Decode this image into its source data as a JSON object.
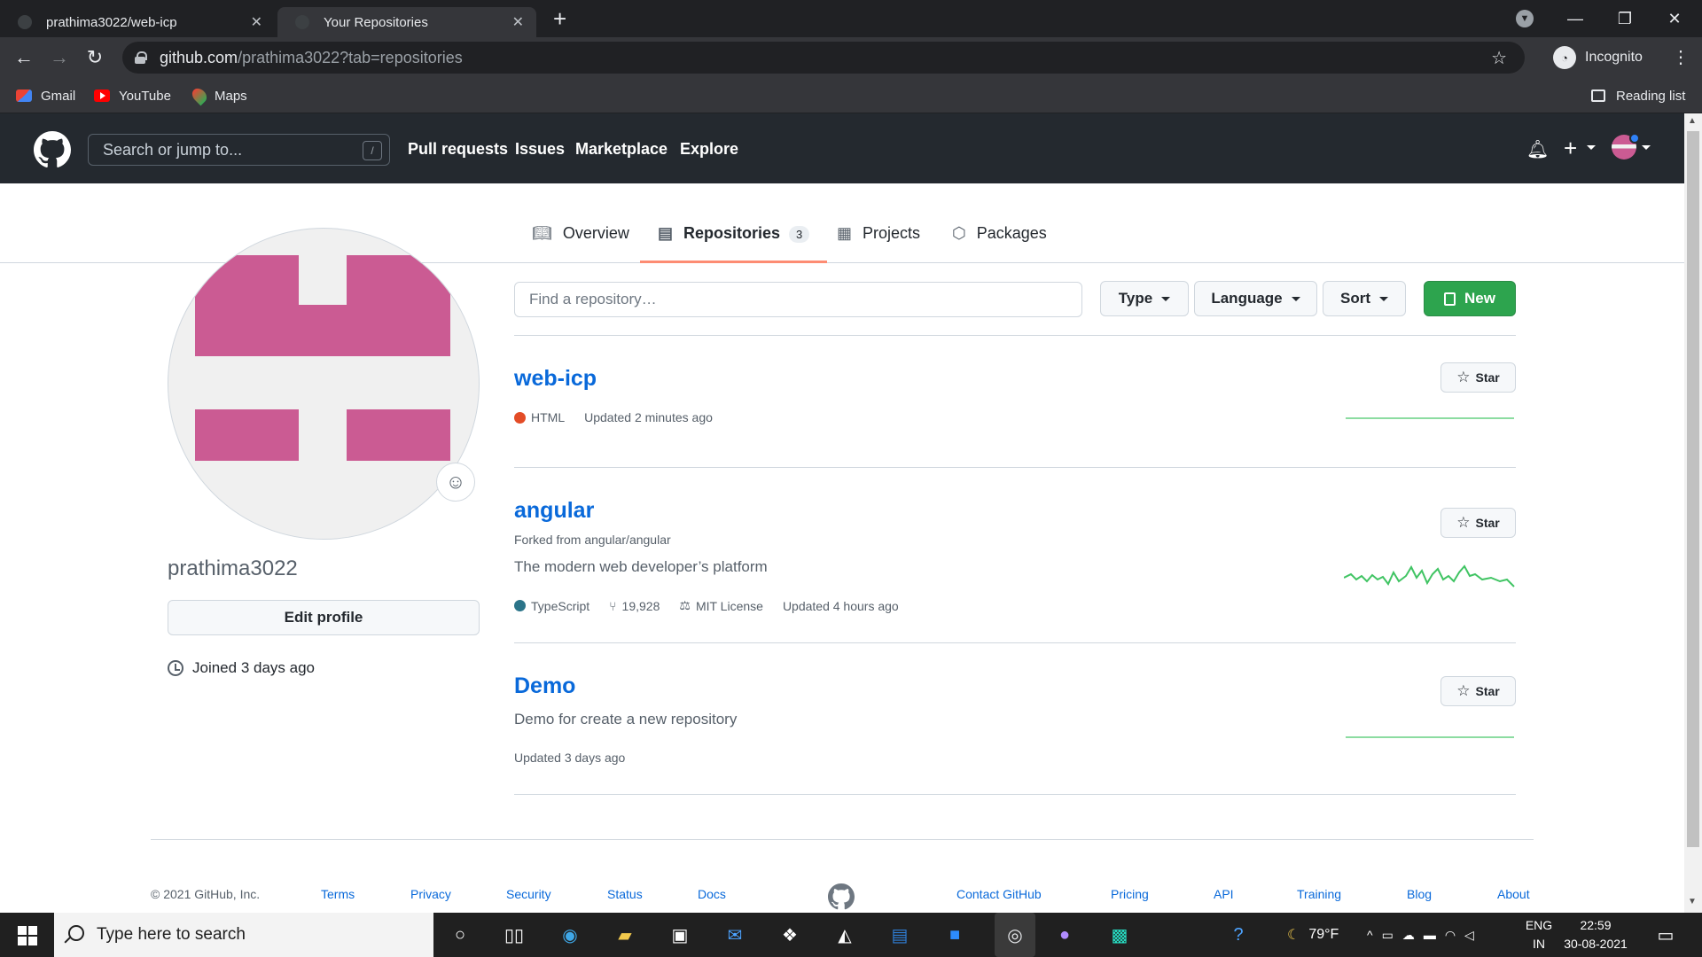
{
  "browser": {
    "tabs": [
      {
        "label": "prathima3022/web-icp",
        "active": false
      },
      {
        "label": "Your Repositories",
        "active": true
      }
    ],
    "url_host": "github.com",
    "url_path": "/prathima3022?tab=repositories",
    "profile_label": "Incognito",
    "bookmarks": [
      "Gmail",
      "YouTube",
      "Maps"
    ],
    "reading_list": "Reading list"
  },
  "github_header": {
    "search_placeholder": "Search or jump to...",
    "search_shortcut": "/",
    "nav": [
      "Pull requests",
      "Issues",
      "Marketplace",
      "Explore"
    ]
  },
  "profile_tabs": [
    {
      "label": "Overview",
      "icon": "book-icon"
    },
    {
      "label": "Repositories",
      "icon": "repo-icon",
      "count": "3",
      "active": true
    },
    {
      "label": "Projects",
      "icon": "project-icon"
    },
    {
      "label": "Packages",
      "icon": "package-icon"
    }
  ],
  "sidebar": {
    "username": "prathima3022",
    "edit_profile": "Edit profile",
    "joined": "Joined 3 days ago",
    "avatar_color": "#cb5b93"
  },
  "filters": {
    "find_placeholder": "Find a repository…",
    "type": "Type",
    "language": "Language",
    "sort": "Sort",
    "new": "New"
  },
  "repos": [
    {
      "name": "web-icp",
      "language": "HTML",
      "language_color": "#e34c26",
      "updated": "Updated 2 minutes ago",
      "star": "Star"
    },
    {
      "name": "angular",
      "forked_from": "Forked from angular/angular",
      "description": "The modern web developer’s platform",
      "language": "TypeScript",
      "language_color": "#2b7489",
      "forks": "19,928",
      "license": "MIT License",
      "updated": "Updated 4 hours ago",
      "star": "Star"
    },
    {
      "name": "Demo",
      "description": "Demo for create a new repository",
      "updated": "Updated 3 days ago",
      "star": "Star"
    }
  ],
  "footer": {
    "copyright": "© 2021 GitHub, Inc.",
    "links": [
      "Terms",
      "Privacy",
      "Security",
      "Status",
      "Docs",
      "Contact GitHub",
      "Pricing",
      "API",
      "Training",
      "Blog",
      "About"
    ]
  },
  "taskbar": {
    "search_placeholder": "Type here to search",
    "weather": "79°F",
    "lang_line1": "ENG",
    "lang_line2": "IN",
    "time": "22:59",
    "date": "30-08-2021"
  }
}
